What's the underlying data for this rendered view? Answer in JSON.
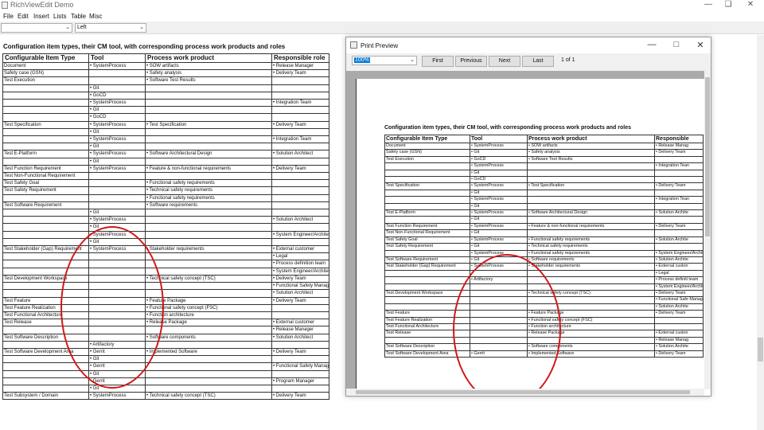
{
  "app": {
    "title": "RichViewEdit Demo"
  },
  "menu": {
    "items": [
      "File",
      "Edit",
      "Insert",
      "Lists",
      "Table",
      "Misc"
    ]
  },
  "toolbar": {
    "style_value": "",
    "align_value": "Left"
  },
  "document": {
    "heading": "Configuration item types, their CM tool, with corresponding process work products and roles",
    "headers": [
      "Configurable Item Type",
      "Tool",
      "Process work product",
      "Responsible role"
    ],
    "rows": [
      [
        "Document",
        "• SystemProcess",
        "• SOW artifacts",
        "• Release Manager"
      ],
      [
        "Safety case (GSN)",
        "",
        "• Safety analysis",
        "• Delivery Team"
      ],
      [
        "Test Execution",
        "",
        "• Software Test Results",
        ""
      ],
      [
        "",
        "• Git",
        "",
        ""
      ],
      [
        "",
        "• GoCD",
        "",
        ""
      ],
      [
        "",
        "• SystemProcess",
        "",
        "• Integration Team"
      ],
      [
        "",
        "• Git",
        "",
        ""
      ],
      [
        "",
        "• GoCD",
        "",
        ""
      ],
      [
        "Test Specification",
        "• SystemProcess",
        "• Test Specification",
        "• Delivery Team"
      ],
      [
        "",
        "• Git",
        "",
        ""
      ],
      [
        "",
        "• SystemProcess",
        "",
        "• Integration Team"
      ],
      [
        "",
        "• Git",
        "",
        ""
      ],
      [
        "Test E-Platform",
        "• SystemProcess",
        "• Software Architectural Design",
        "• Solution Architect"
      ],
      [
        "",
        "• Git",
        "",
        ""
      ],
      [
        "Test Function Requirement",
        "• SystemProcess",
        "• Feature & non-functional requirements",
        "• Delivery Team"
      ],
      [
        "Test Non-Functional Requirement",
        "",
        "",
        ""
      ],
      [
        "Test Safety Goal",
        "",
        "• Functional safety requirements",
        ""
      ],
      [
        "Test Safety Requirement",
        "",
        "• Technical safety requirements",
        ""
      ],
      [
        "",
        "",
        "• Functional safety requirements",
        ""
      ],
      [
        "Test Software Requirement",
        "",
        "• Software requirements",
        ""
      ],
      [
        "",
        "• Git",
        "",
        ""
      ],
      [
        "",
        "• SystemProcess",
        "",
        "• Solution Architect"
      ],
      [
        "",
        "• Git",
        "",
        ""
      ],
      [
        "",
        "• SystemProcess",
        "",
        "• System Engineer/Architect"
      ],
      [
        "",
        "• Git",
        "",
        ""
      ],
      [
        "Test Stakeholder (Gap) Requirement",
        "• SystemProcess",
        "• Stakeholder requirements",
        "• External customer"
      ],
      [
        "",
        "",
        "",
        "• Legal"
      ],
      [
        "",
        "",
        "",
        "• Process definition team"
      ],
      [
        "",
        "",
        "",
        "• System Engineer/Architect"
      ],
      [
        "Test Development Workspace",
        "",
        "• Technical safety concept (TSC)",
        "• Delivery Team"
      ],
      [
        "",
        "",
        "",
        "• Functional Safety Manager"
      ],
      [
        "",
        "",
        "",
        "• Solution Architect"
      ],
      [
        "Test Feature",
        "",
        "• Feature Package",
        "• Delivery Team"
      ],
      [
        "Test Feature Realization",
        "",
        "• Functional safety concept (FSC)",
        ""
      ],
      [
        "Test Functional Architecture",
        "",
        "• Function architecture",
        ""
      ],
      [
        "Test Release",
        "",
        "• Release Package",
        "• External customer"
      ],
      [
        "",
        "",
        "",
        "• Release Manager"
      ],
      [
        "Test Software Description",
        "",
        "• Software components",
        "• Solution Architect"
      ],
      [
        "",
        "• Artifactory",
        "",
        ""
      ],
      [
        "Test Software Development Area",
        "• Gerrit",
        "• Implemented Software",
        "• Delivery Team"
      ],
      [
        "",
        "• Git",
        "",
        ""
      ],
      [
        "",
        "• Gerrit",
        "",
        "• Functional Safety Manager"
      ],
      [
        "",
        "• Git",
        "",
        ""
      ],
      [
        "",
        "• Gerrit",
        "",
        "• Program Manager"
      ],
      [
        "",
        "• Git",
        "",
        ""
      ],
      [
        "Test Subsystem / Domain",
        "• SystemProcess",
        "• Technical safety concept (TSC)",
        "• Delivery Team"
      ]
    ]
  },
  "preview": {
    "title": "Print Preview",
    "zoom": "100%",
    "buttons": {
      "first": "First",
      "previous": "Previous",
      "next": "Next",
      "last": "Last"
    },
    "page_info": "1 of 1",
    "heading": "Configuration item types, their CM tool, with corresponding process work products and roles",
    "headers": [
      "Configurable Item Type",
      "Tool",
      "Process work product",
      "Responsible"
    ],
    "rows": [
      [
        "Document",
        "• SystemProcess",
        "• SOW artifacts",
        "• Release Manag"
      ],
      [
        "Safety case (GSN)",
        "• Git",
        "• Safety analysis",
        "• Delivery Team"
      ],
      [
        "Test Execution",
        "• GoCD",
        "• Software Test Results",
        ""
      ],
      [
        "",
        "• SystemProcess",
        "",
        "• Integration Tean"
      ],
      [
        "",
        "• Git",
        "",
        ""
      ],
      [
        "",
        "• GoCD",
        "",
        ""
      ],
      [
        "Test Specification",
        "• SystemProcess",
        "• Test Specification",
        "• Delivery Team"
      ],
      [
        "",
        "• Git",
        "",
        ""
      ],
      [
        "",
        "• SystemProcess",
        "",
        "• Integration Tean"
      ],
      [
        "",
        "• Git",
        "",
        ""
      ],
      [
        "Test E-Platform",
        "• SystemProcess",
        "• Software Architectural Design",
        "• Solution Archite"
      ],
      [
        "",
        "• Git",
        "",
        ""
      ],
      [
        "Test Function Requirement",
        "• SystemProcess",
        "• Feature & non-functional requirements",
        "• Delivery Team"
      ],
      [
        "Test Non-Functional Requirement",
        "• Git",
        "",
        ""
      ],
      [
        "Test Safety Goal",
        "• SystemProcess",
        "• Functional safety requirements",
        "• Solution Archite"
      ],
      [
        "Test Safety Requirement",
        "• Git",
        "• Technical safety requirements",
        ""
      ],
      [
        "",
        "• SystemProcess",
        "• Functional safety requirements",
        "• System Engineer/Archite"
      ],
      [
        "Test Software Requirement",
        "• Git",
        "• Software requirements",
        "• Solution Archite"
      ],
      [
        "Test Stakeholder (Gap) Requirement",
        "• SystemProcess",
        "• Stakeholder requirements",
        "• External custon"
      ],
      [
        "",
        "",
        "",
        "• Legal"
      ],
      [
        "",
        "• Artifactory",
        "",
        "• Process definiti team"
      ],
      [
        "",
        "",
        "",
        "• System Engineer/Archite"
      ],
      [
        "Test Development Workspace",
        "",
        "• Technical safety concept (TSC)",
        "• Delivery Team"
      ],
      [
        "",
        "",
        "",
        "• Functional Safe Manager"
      ],
      [
        "",
        "",
        "",
        "• Solution Archite"
      ],
      [
        "Test Feature",
        "",
        "• Feature Package",
        "• Delivery Team"
      ],
      [
        "Test Feature Realization",
        "",
        "• Functional safety concept (FSC)",
        ""
      ],
      [
        "Test Functional Architecture",
        "",
        "• Function architecture",
        ""
      ],
      [
        "Test Release",
        "",
        "• Release Package",
        "• External custon"
      ],
      [
        "",
        "",
        "",
        "• Release Manag"
      ],
      [
        "Test Software Description",
        "",
        "• Software components",
        "• Solution Archite"
      ],
      [
        "Test Software Development Area",
        "• Gerrit",
        "• Implemented Software",
        "• Delivery Team"
      ]
    ]
  }
}
